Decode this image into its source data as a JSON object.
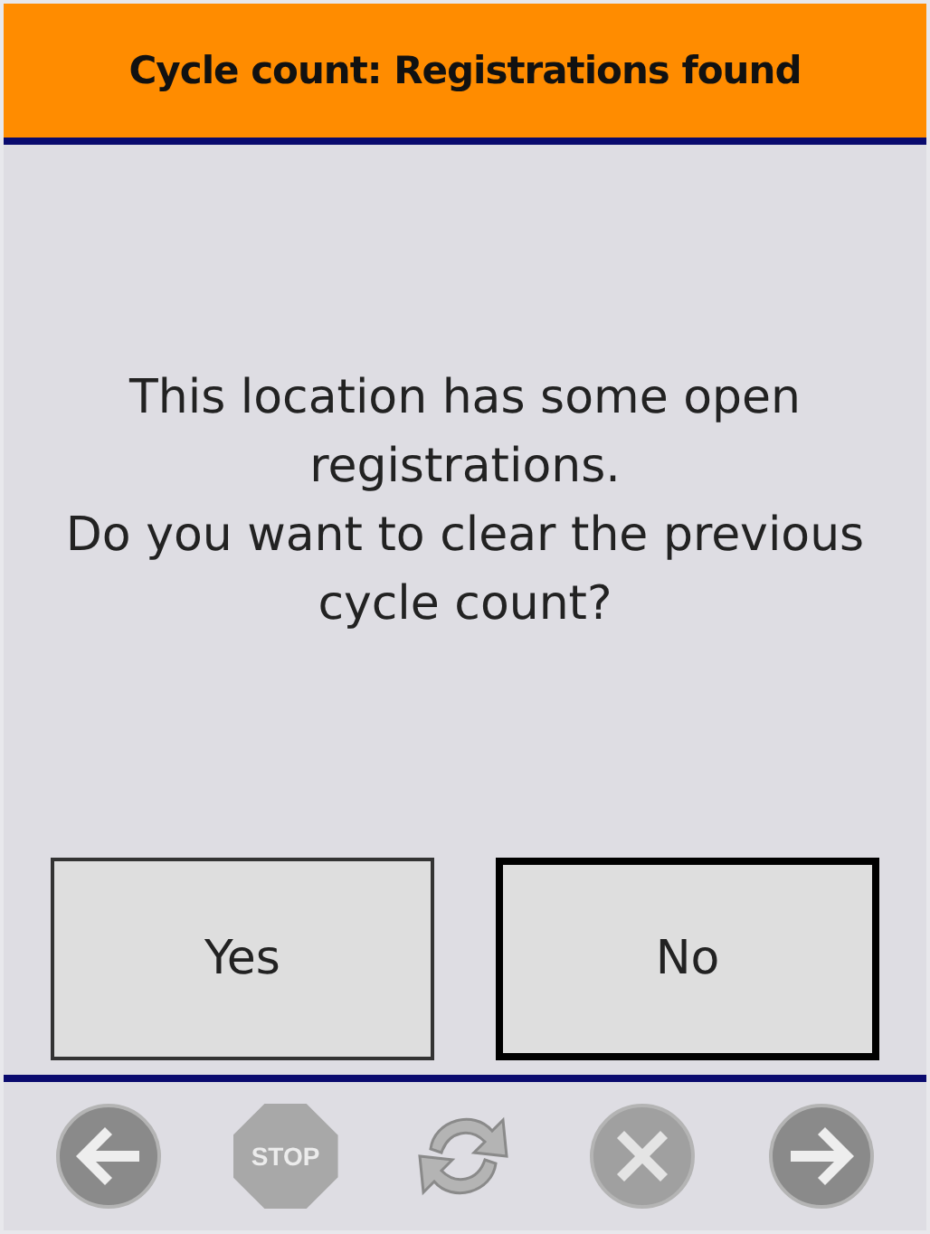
{
  "header": {
    "title": "Cycle count: Registrations found"
  },
  "message": [
    "This location has some open registrations.",
    "Do you want to clear the previous cycle count?"
  ],
  "buttons": [
    {
      "label": "Yes",
      "focused": false
    },
    {
      "label": "No",
      "focused": true
    }
  ],
  "toolbar": [
    {
      "kind": "back",
      "disabled": true
    },
    {
      "kind": "stop",
      "label": "STOP",
      "disabled": true
    },
    {
      "kind": "refresh",
      "disabled": true
    },
    {
      "kind": "cancel",
      "disabled": true
    },
    {
      "kind": "forward",
      "disabled": true
    }
  ]
}
